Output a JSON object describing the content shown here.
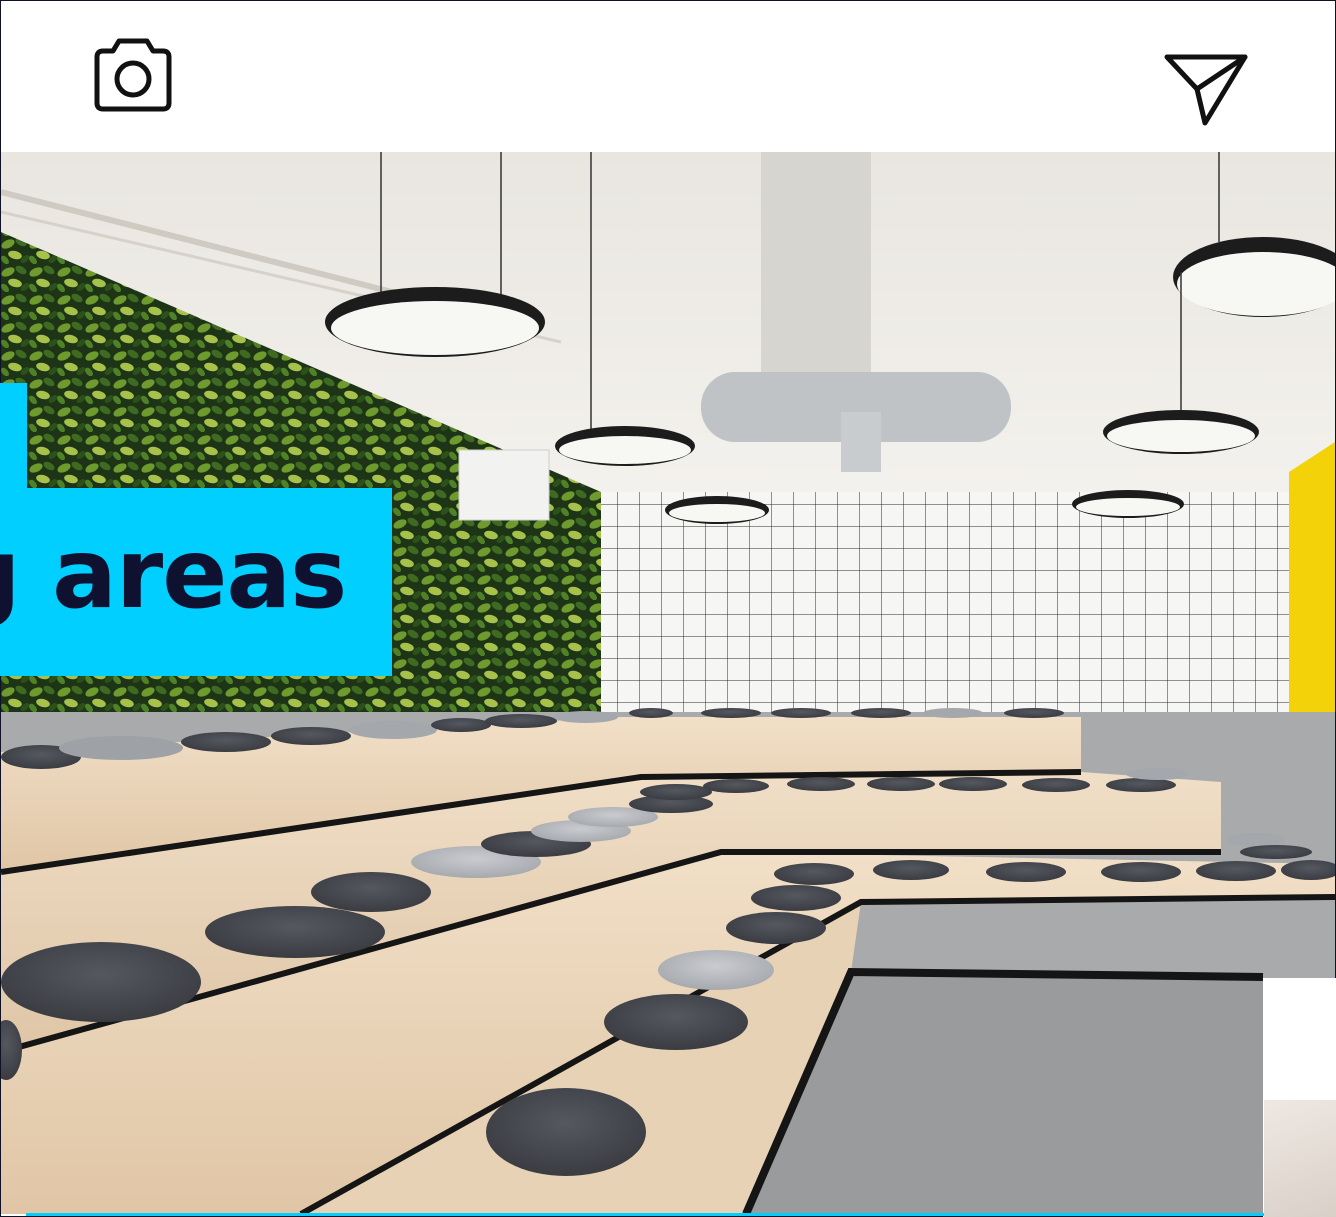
{
  "toolbar": {
    "camera_icon": "camera-icon",
    "send_icon": "send-icon"
  },
  "banner": {
    "text": "g areas"
  },
  "colors": {
    "accent": "#00cfff",
    "banner_text": "#0e1130",
    "background": "#ffffff"
  }
}
